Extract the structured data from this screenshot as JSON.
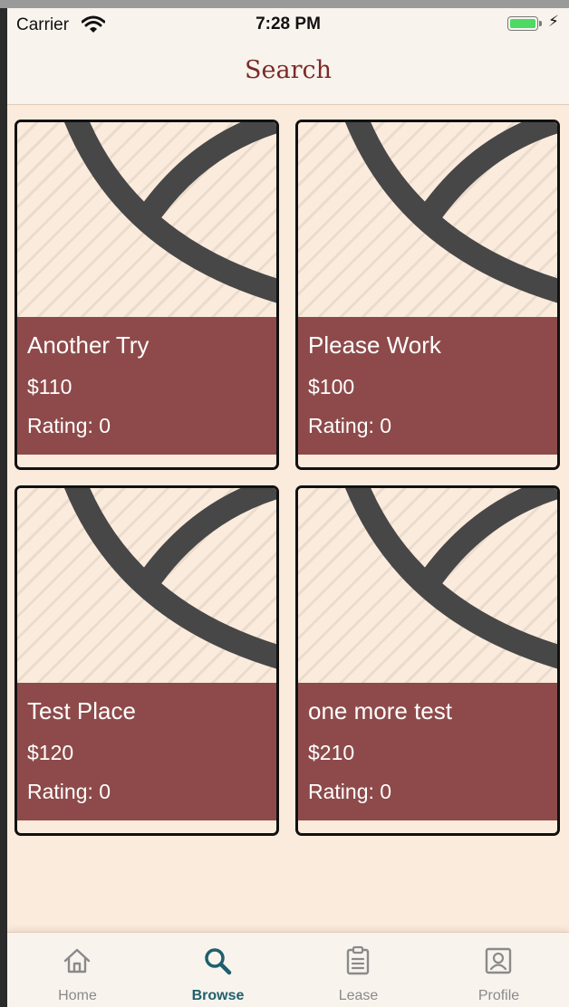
{
  "status_bar": {
    "carrier": "Carrier",
    "time": "7:28 PM",
    "battery_color": "#4cd964"
  },
  "nav": {
    "title": "Search",
    "title_color": "#7b2b28"
  },
  "listings": [
    {
      "title": "Another Try",
      "price": "$110",
      "rating": "Rating: 0"
    },
    {
      "title": "Please Work",
      "price": "$100",
      "rating": "Rating: 0"
    },
    {
      "title": "Test Place",
      "price": "$120",
      "rating": "Rating: 0"
    },
    {
      "title": "one more test",
      "price": "$210",
      "rating": "Rating: 0"
    }
  ],
  "card_colors": {
    "info_bg": "#8e4a4a",
    "image_bg": "#fbebdc",
    "arc": "#474747"
  },
  "tabs": [
    {
      "label": "Home",
      "icon": "home-icon",
      "active": false
    },
    {
      "label": "Browse",
      "icon": "search-icon",
      "active": true
    },
    {
      "label": "Lease",
      "icon": "clipboard-icon",
      "active": false
    },
    {
      "label": "Profile",
      "icon": "profile-icon",
      "active": false
    }
  ],
  "tab_colors": {
    "active": "#1f5f6b",
    "inactive": "#8a8a8a"
  }
}
